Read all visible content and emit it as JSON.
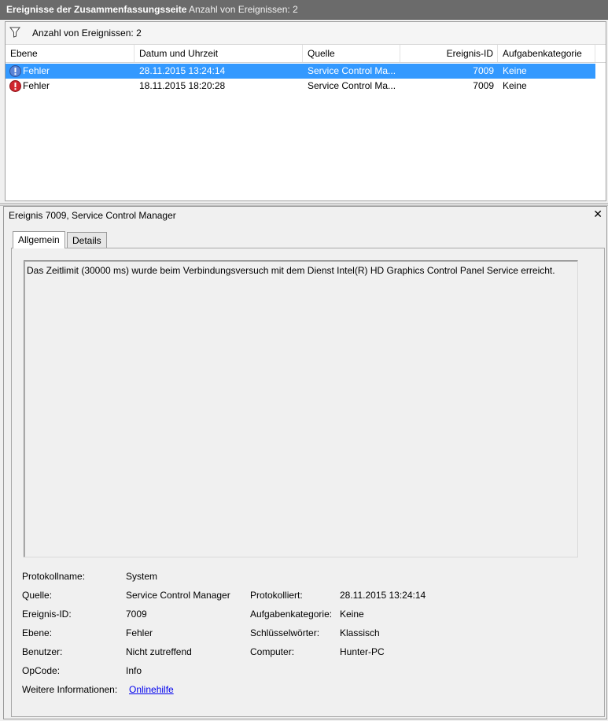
{
  "header": {
    "title": "Ereignisse der Zusammenfassungsseite",
    "count_label": "Anzahl von Ereignissen: 2"
  },
  "filter": {
    "icon": "filter-icon",
    "text": "Anzahl von Ereignissen: 2"
  },
  "table": {
    "columns": [
      "Ebene",
      "Datum und Uhrzeit",
      "Quelle",
      "Ereignis-ID",
      "Aufgabenkategorie"
    ],
    "rows": [
      {
        "level": "Fehler",
        "datetime": "28.11.2015 13:24:14",
        "source": "Service Control Ma...",
        "event_id": "7009",
        "category": "Keine",
        "selected": true
      },
      {
        "level": "Fehler",
        "datetime": "18.11.2015 18:20:28",
        "source": "Service Control Ma...",
        "event_id": "7009",
        "category": "Keine",
        "selected": false
      }
    ]
  },
  "detail": {
    "title": "Ereignis 7009, Service Control Manager",
    "close_glyph": "✕",
    "tabs": [
      "Allgemein",
      "Details"
    ],
    "message": "Das Zeitlimit (30000 ms) wurde beim Verbindungsversuch mit dem Dienst Intel(R) HD Graphics Control Panel Service erreicht.",
    "labels": {
      "log_name": "Protokollname:",
      "source": "Quelle:",
      "event_id": "Ereignis-ID:",
      "level": "Ebene:",
      "user": "Benutzer:",
      "opcode": "OpCode:",
      "more_info": "Weitere Informationen:",
      "logged": "Protokolliert:",
      "task_category": "Aufgabenkategorie:",
      "keywords": "Schlüsselwörter:",
      "computer": "Computer:"
    },
    "values": {
      "log_name": "System",
      "source": "Service Control Manager",
      "event_id": "7009",
      "level": "Fehler",
      "user": "Nicht zutreffend",
      "opcode": "Info",
      "more_info": "Onlinehilfe",
      "logged": "28.11.2015 13:24:14",
      "task_category": "Keine",
      "keywords": "Klassisch",
      "computer": "Hunter-PC"
    }
  },
  "colors": {
    "selection": "#3399ff",
    "error_icon": "#d0262e",
    "header_bar": "#6b6b6b",
    "link": "#0000ee"
  }
}
